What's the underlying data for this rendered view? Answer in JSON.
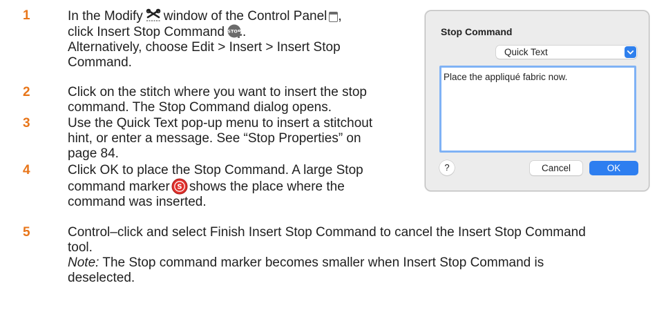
{
  "steps": [
    {
      "num": "1",
      "l1_a": "In the Modify",
      "l1_b": "window of the Control Panel",
      "l2_a": "click Insert Stop Command",
      "l2_b": ".",
      "l3": "Alternatively, choose Edit > Insert > Insert Stop",
      "l4": "Command."
    },
    {
      "num": "2",
      "l1": "Click on the stitch where you want to insert the stop",
      "l2": "command. The Stop Command dialog opens."
    },
    {
      "num": "3",
      "l1": "Use the Quick Text pop-up menu to insert a stitchout",
      "l2": "hint, or enter a message. See “Stop Properties” on",
      "l3": "page 84."
    },
    {
      "num": "4",
      "l1": "Click OK to place the Stop Command. A large Stop",
      "l2_a": "command marker",
      "l2_b": "shows the place where the",
      "l3": "command was inserted."
    },
    {
      "num": "5",
      "l1": "Control–click and select Finish Insert Stop Command to cancel the Insert Stop Command",
      "l2": "tool.",
      "note_label": "Note:",
      "note_l1": " The Stop command marker becomes smaller when Insert Stop Command is",
      "note_l2": "deselected."
    }
  ],
  "step1_comma": ",",
  "icons": {
    "modify": "scissors-icon",
    "control_panel": "control-panel-icon",
    "insert_stop": "insert-stop-command-icon",
    "stop_marker": "stop-marker-icon",
    "stop_tool_text": "STOP",
    "stop_marker_text": "S"
  },
  "colors": {
    "step_number": "#e8761a",
    "accent_blue": "#2d7ef0",
    "focus_ring": "#7fb2f5",
    "stop_red": "#e0302c"
  },
  "dialog": {
    "title": "Stop Command",
    "quick_text_value": "Quick Text",
    "message": "Place the appliqué fabric now.",
    "help_label": "?",
    "cancel_label": "Cancel",
    "ok_label": "OK"
  }
}
